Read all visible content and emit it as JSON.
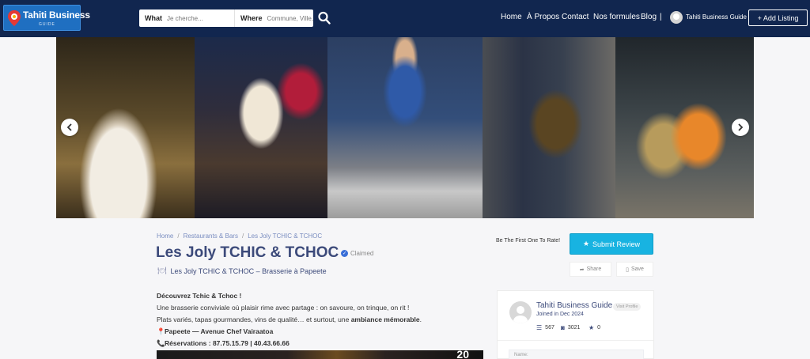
{
  "header": {
    "logo": {
      "brand": "Tahiti Business",
      "tagline": "GUIDE"
    },
    "search": {
      "what_label": "What",
      "what_placeholder": "Je cherche...",
      "where_label": "Where",
      "where_placeholder": "Commune, Ville, ..."
    },
    "nav": [
      "Home",
      "À Propos",
      "Contact",
      "Nos formules",
      "Blog"
    ],
    "nav_separator": "|",
    "user_name": "Tahiti Business Guide",
    "add_listing": "+ Add Listing",
    "background_color": "#11264f"
  },
  "gallery": {
    "photos": [
      "pasta-dish",
      "tapas-buffet",
      "woman-with-cocktails",
      "restaurant-interior",
      "owners-with-aprons"
    ],
    "prev_icon": "chevron-left-icon",
    "next_icon": "chevron-right-icon"
  },
  "listing": {
    "breadcrumb": [
      "Home",
      "Restaurants & Bars",
      "Les Joly TCHIC & TCHOC"
    ],
    "title": "Les Joly TCHIC & TCHOC",
    "claimed": "Claimed",
    "subtitle": "Les Joly TCHIC & TCHOC – Brasserie à Papeete",
    "rate_prompt": "Be The First One To Rate!",
    "submit_review": "Submit Review",
    "share": "Share",
    "save": "Save",
    "accent_color": "#18b3e1"
  },
  "description": {
    "heading": "Découvrez Tchic & Tchoc !",
    "line1": "Une brasserie conviviale où plaisir rime avec partage : on savoure, on trinque, on rit !",
    "line2_start": "Plats variés, tapas gourmandes, vins de qualité… et surtout, une ",
    "line2_bold": "ambiance mémorable",
    "line2_end": ".",
    "address": "Papeete — Avenue Chef Vairaatoa",
    "reservations": "Réservations : 87.75.15.79 | 40.43.66.66",
    "promo_number": "20"
  },
  "owner_card": {
    "name": "Tahiti Business Guide",
    "visit_profile": "Visit Profile",
    "joined": "Joined in Dec 2024",
    "listings": "567",
    "photos": "3021",
    "reviews": "0",
    "name_field_label": "Name:"
  }
}
